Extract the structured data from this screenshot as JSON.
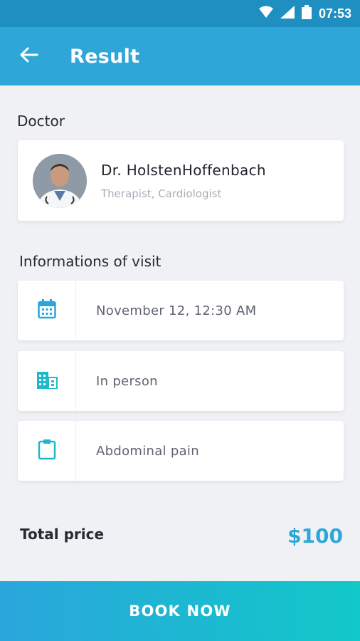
{
  "status_bar": {
    "time": "07:53",
    "icons": [
      "wifi-icon",
      "signal-icon",
      "battery-icon"
    ]
  },
  "app_bar": {
    "title": "Result",
    "back_icon": "arrow-left-icon"
  },
  "doctor_section": {
    "label": "Doctor",
    "name": "Dr. HolstenHoffenbach",
    "specialty": "Therapist, Cardiologist"
  },
  "visit_section": {
    "label": "Informations of visit",
    "items": [
      {
        "icon": "calendar-icon",
        "text": "November 12,  12:30 AM"
      },
      {
        "icon": "building-icon",
        "text": "In person"
      },
      {
        "icon": "clipboard-icon",
        "text": "Abdominal pain"
      }
    ]
  },
  "total": {
    "label": "Total price",
    "price": "$100"
  },
  "book_button": {
    "label": "BOOK NOW"
  },
  "colors": {
    "status_bar": "#1e8fc0",
    "app_bar": "#2ea7d8",
    "accent": "#2ea7d8",
    "icon": "#1fb9c9",
    "background": "#f0f1f5",
    "button_gradient_start": "#2aa6dc",
    "button_gradient_end": "#12c8c8"
  }
}
